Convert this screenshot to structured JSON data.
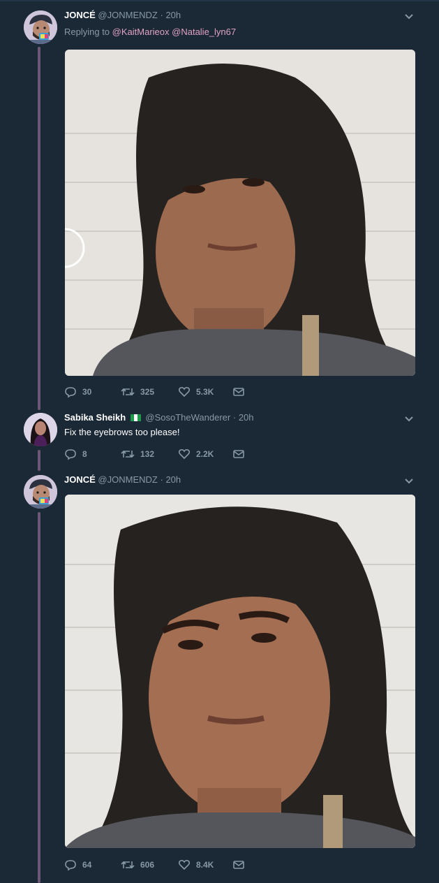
{
  "tweets": [
    {
      "name": "JONCÉ",
      "handle": "@JONMENDZ",
      "sep": "·",
      "time": "20h",
      "replying_label": "Replying to",
      "replying_to": [
        "@KaitMarieox",
        "@Natalie_lyn67"
      ],
      "replies": "30",
      "retweets": "325",
      "likes": "5.3K"
    },
    {
      "name": "Sabika Sheikh",
      "flag": "nigeria-flag",
      "handle": "@SosoTheWanderer",
      "sep": "·",
      "time": "20h",
      "text": "Fix the eyebrows too please!",
      "replies": "8",
      "retweets": "132",
      "likes": "2.2K"
    },
    {
      "name": "JONCÉ",
      "handle": "@JONMENDZ",
      "sep": "·",
      "time": "20h",
      "replies": "64",
      "retweets": "606",
      "likes": "8.4K"
    }
  ],
  "icons": {
    "reply": "reply-icon",
    "retweet": "retweet-icon",
    "like": "heart-icon",
    "dm": "envelope-icon",
    "more": "chevron-down-icon"
  },
  "colors": {
    "background": "#1b2836",
    "secondary_text": "#8899a6",
    "mention": "#e0a3c4",
    "thread_line": "#6b5877"
  }
}
